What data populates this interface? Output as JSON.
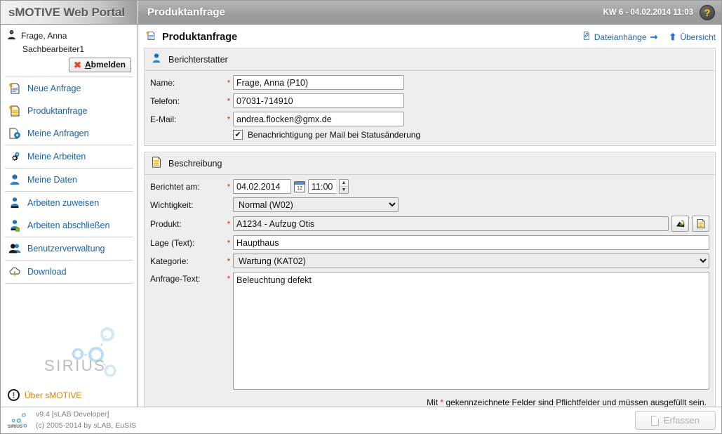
{
  "topbar": {
    "brand": "sMOTIVE Web Portal",
    "page_title": "Produktanfrage",
    "date_info": "KW 6 - 04.02.2014 11:03",
    "help_glyph": "?"
  },
  "sidebar": {
    "user_name": "Frage, Anna",
    "user_role": "Sachbearbeiter1",
    "logout_label": "Abmelden",
    "logout_accesskey": "A",
    "items": [
      {
        "label": "Neue Anfrage",
        "icon": "new-request-icon"
      },
      {
        "label": "Produktanfrage",
        "icon": "product-request-icon"
      },
      {
        "label": "Meine Anfragen",
        "icon": "my-requests-icon"
      },
      {
        "label": "Meine Arbeiten",
        "icon": "gear-icon"
      },
      {
        "label": "Meine Daten",
        "icon": "person-icon"
      },
      {
        "label": "Arbeiten zuweisen",
        "icon": "assign-work-icon"
      },
      {
        "label": "Arbeiten abschließen",
        "icon": "complete-work-icon"
      },
      {
        "label": "Benutzerverwaltung",
        "icon": "users-icon"
      },
      {
        "label": "Download",
        "icon": "download-cloud-icon"
      }
    ],
    "logo_text": "SIRIUS",
    "about_label": "Über sMOTIVE"
  },
  "content": {
    "title": "Produktanfrage",
    "attachments_link": "Dateianhänge",
    "overview_link": "Übersicht",
    "reporter_panel": {
      "heading": "Berichterstatter",
      "fields": {
        "name_label": "Name:",
        "name_value": "Frage, Anna (P10)",
        "phone_label": "Telefon:",
        "phone_value": "07031-714910",
        "email_label": "E-Mail:",
        "email_value": "andrea.flocken@gmx.de"
      },
      "notify_checkbox_label": "Benachrichtigung per Mail bei Statusänderung",
      "notify_checked": true,
      "check_glyph": "✔"
    },
    "description_panel": {
      "heading": "Beschreibung",
      "reported_label": "Berichtet am:",
      "reported_date": "04.02.2014",
      "reported_time": "11:00",
      "priority_label": "Wichtigkeit:",
      "priority_value": "Normal (W02)",
      "priority_options": [
        "Normal (W02)"
      ],
      "product_label": "Produkt:",
      "product_value": "A1234 - Aufzug Otis",
      "location_label": "Lage (Text):",
      "location_value": "Haupthaus",
      "category_label": "Kategorie:",
      "category_value": "Wartung (KAT02)",
      "category_options": [
        "Wartung (KAT02)"
      ],
      "request_text_label": "Anfrage-Text:",
      "request_text_value": "Beleuchtung defekt",
      "mandatory_hint_pre": "Mit",
      "mandatory_hint_star": "*",
      "mandatory_hint_post": "gekennzeichnete Felder sind Pflichtfelder und müssen ausgefüllt sein."
    }
  },
  "footer": {
    "version": "v9.4 [sLAB Developer]",
    "copyright": "(c) 2005-2014 by sLAB, EuSIS",
    "logo_text": "SIRIUS",
    "submit_label": "Erfassen"
  },
  "colors": {
    "link": "#1862ab",
    "accent_orange": "#d98200",
    "required_red": "#d93025",
    "panel_bg": "#eeeeee",
    "help_yellow": "#ffd21e"
  }
}
